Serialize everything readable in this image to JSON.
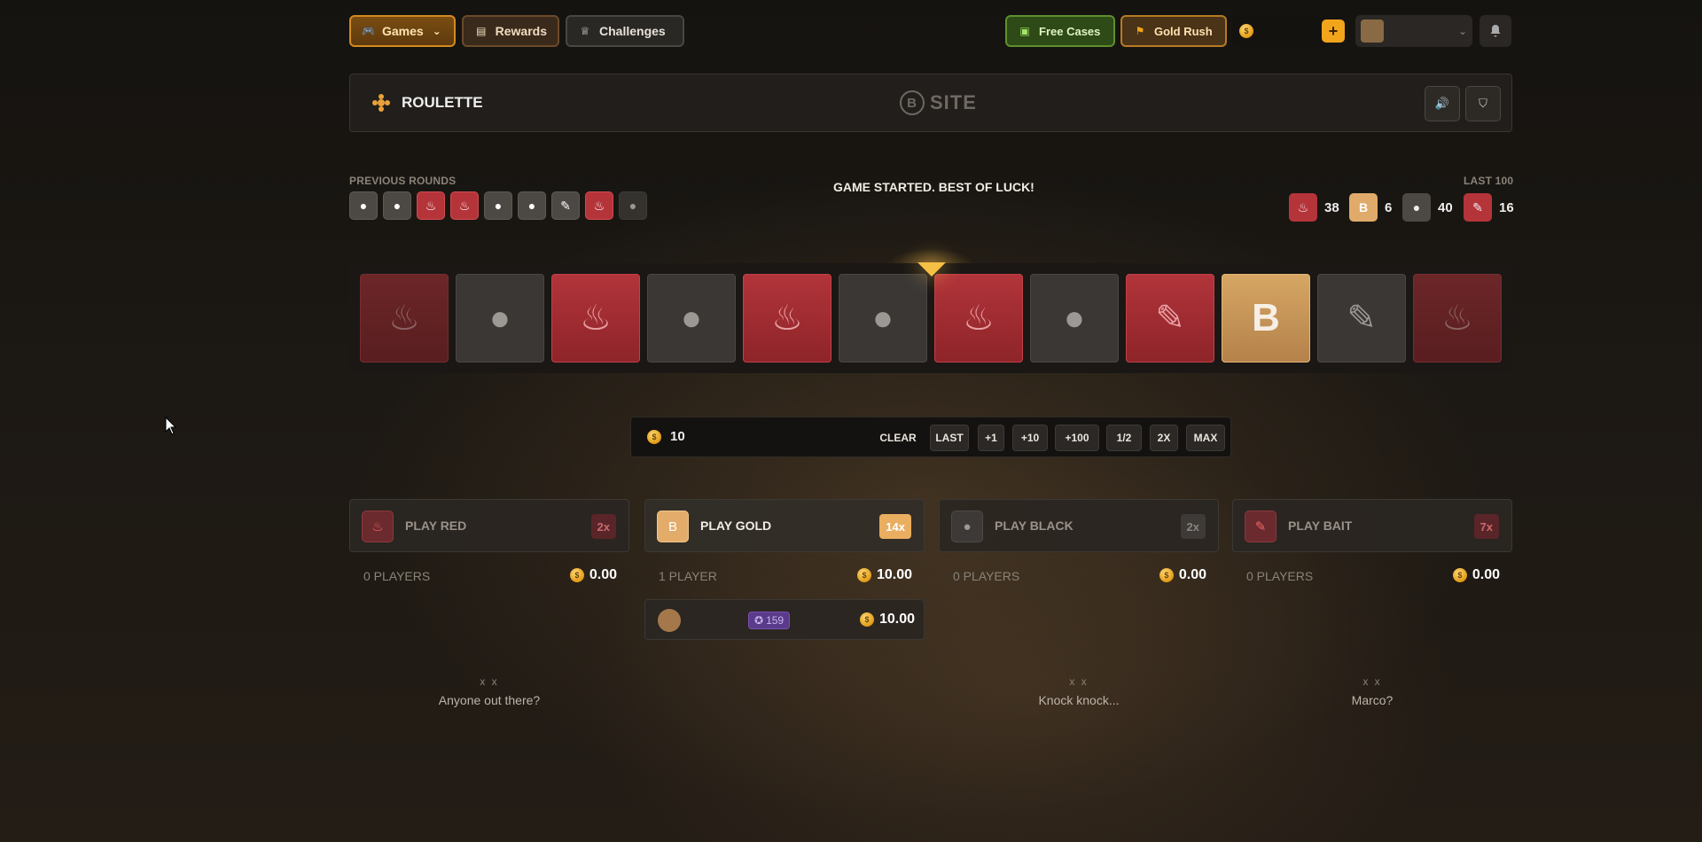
{
  "nav": {
    "games": "Games",
    "rewards": "Rewards",
    "challenges": "Challenges",
    "free_cases": "Free Cases",
    "gold_rush": "Gold Rush",
    "plus": "+"
  },
  "game": {
    "title": "ROULETTE",
    "logo_text": "SITE"
  },
  "previous_rounds": {
    "label": "PREVIOUS ROUNDS",
    "results": [
      "black",
      "black",
      "red",
      "red",
      "black",
      "black",
      "bait-black",
      "red",
      "black"
    ]
  },
  "status_message": "GAME STARTED. BEST OF LUCK!",
  "last100": {
    "label": "LAST 100",
    "red": "38",
    "gold": "6",
    "black": "40",
    "bait": "16"
  },
  "reel": [
    "red",
    "black",
    "red",
    "black",
    "red",
    "black",
    "red",
    "black",
    "bait-red",
    "gold",
    "bait-black",
    "red"
  ],
  "bet": {
    "amount": "10",
    "clear": "CLEAR",
    "last": "LAST",
    "plus1": "+1",
    "plus10": "+10",
    "plus100": "+100",
    "half": "1/2",
    "double": "2X",
    "max": "MAX"
  },
  "panels": [
    {
      "label": "PLAY RED",
      "mult": "2x",
      "players": "0 PLAYERS",
      "total": "0.00",
      "empty": "Anyone out there?"
    },
    {
      "label": "PLAY GOLD",
      "mult": "14x",
      "players": "1 PLAYER",
      "total": "10.00"
    },
    {
      "label": "PLAY BLACK",
      "mult": "2x",
      "players": "0 PLAYERS",
      "total": "0.00",
      "empty": "Knock knock..."
    },
    {
      "label": "PLAY BAIT",
      "mult": "7x",
      "players": "0 PLAYERS",
      "total": "0.00",
      "empty": "Marco?"
    }
  ],
  "gold_bet": {
    "level": "159",
    "amount": "10.00"
  },
  "colors": {
    "red": "#b5343a",
    "gold": "#d6a664",
    "black": "#3a3735",
    "accent": "#f2a51b"
  },
  "empty_face": "x x"
}
